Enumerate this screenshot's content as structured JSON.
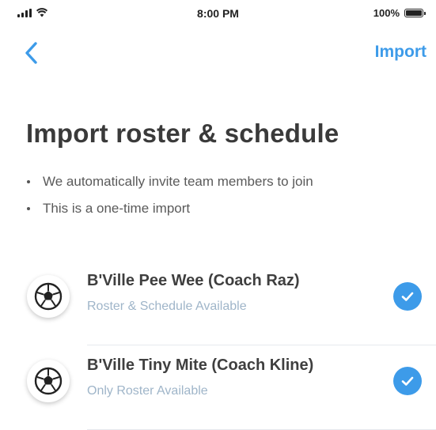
{
  "status_bar": {
    "time": "8:00 PM",
    "battery": "100%",
    "icons": [
      "signal-icon",
      "wifi-icon",
      "battery-icon"
    ]
  },
  "nav": {
    "back_icon": "chevron-left-icon",
    "import_label": "Import"
  },
  "title": "Import roster & schedule",
  "bullets": [
    "We automatically invite team members to join",
    "This is a one-time import"
  ],
  "teams": [
    {
      "name": "B'Ville Pee Wee (Coach Raz)",
      "subtitle": "Roster & Schedule Available",
      "selected": true,
      "icon": "soccer-ball-icon"
    },
    {
      "name": "B'Ville Tiny Mite (Coach Kline)",
      "subtitle": "Only Roster Available",
      "selected": true,
      "icon": "soccer-ball-icon"
    }
  ],
  "colors": {
    "accent": "#3d9be9",
    "title": "#3a3a3a",
    "subtitle": "#9fb5c9"
  }
}
